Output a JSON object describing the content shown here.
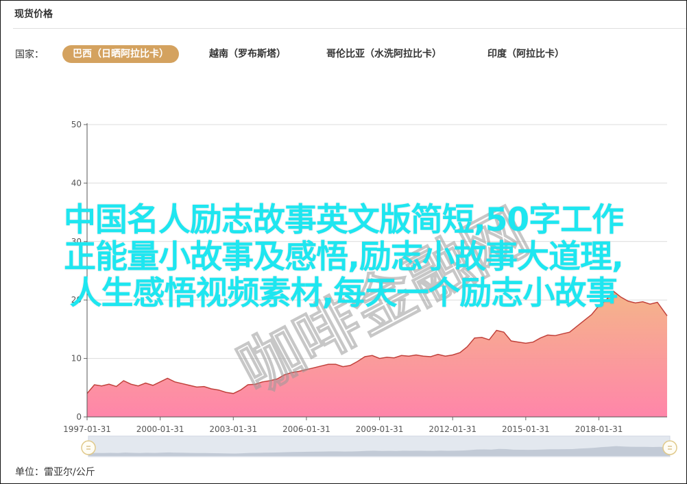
{
  "panel": {
    "title": "现货价格",
    "country_label": "国家：",
    "tabs": [
      {
        "label": "巴西（日晒阿拉比卡）",
        "active": true
      },
      {
        "label": "越南（罗布斯塔）",
        "active": false
      },
      {
        "label": "哥伦比亚（水洗阿拉比卡）",
        "active": false
      },
      {
        "label": "印度（阿拉比卡）",
        "active": false
      }
    ],
    "unit": "单位：雷亚尔/公斤",
    "accent": "#d4a25f"
  },
  "overlay": {
    "line1": "中国名人励志故事英文版简短,50字工作",
    "line2": "正能量小故事及感悟,励志小故事大道理,",
    "line3": "人生感悟视频素材,每天一个励志小故事",
    "color": "#1ee6f0"
  },
  "watermark": {
    "text": "咖啡金融网"
  },
  "chart_data": {
    "type": "area",
    "x_tick_labels": [
      "1997-01-31",
      "2000-01-31",
      "2003-01-31",
      "2006-01-31",
      "2009-01-31",
      "2012-01-31",
      "2015-01-31",
      "2018-01-31"
    ],
    "y_ticks": [
      0,
      10,
      20,
      30,
      40,
      50
    ],
    "ylim": [
      0,
      50
    ],
    "xlim": [
      1997.0,
      2020.8
    ],
    "grid": true,
    "colors": {
      "top": "#f4b183",
      "bottom": "#ff7fa5",
      "line": "#c0403a"
    },
    "data_zoom": {
      "start": 0,
      "end": 100
    },
    "x": [
      1997.0,
      1997.3,
      1997.6,
      1997.9,
      1998.2,
      1998.5,
      1998.8,
      1999.1,
      1999.4,
      1999.7,
      2000.0,
      2000.3,
      2000.6,
      2000.9,
      2001.2,
      2001.5,
      2001.8,
      2002.1,
      2002.4,
      2002.7,
      2003.0,
      2003.3,
      2003.6,
      2003.9,
      2004.2,
      2004.5,
      2004.8,
      2005.1,
      2005.4,
      2005.7,
      2006.0,
      2006.3,
      2006.6,
      2006.9,
      2007.2,
      2007.5,
      2007.8,
      2008.1,
      2008.4,
      2008.7,
      2009.0,
      2009.3,
      2009.6,
      2009.9,
      2010.2,
      2010.5,
      2010.8,
      2011.1,
      2011.4,
      2011.7,
      2012.0,
      2012.3,
      2012.6,
      2012.9,
      2013.2,
      2013.5,
      2013.8,
      2014.1,
      2014.4,
      2014.7,
      2015.0,
      2015.3,
      2015.6,
      2015.9,
      2016.2,
      2016.5,
      2016.8,
      2017.1,
      2017.4,
      2017.7,
      2018.0,
      2018.3,
      2018.6,
      2018.9,
      2019.2,
      2019.5,
      2019.8,
      2020.1,
      2020.4,
      2020.8
    ],
    "values": [
      4.0,
      5.5,
      5.3,
      5.6,
      5.2,
      6.2,
      5.6,
      5.3,
      5.8,
      5.4,
      6.0,
      6.6,
      6.0,
      5.7,
      5.4,
      5.1,
      5.2,
      4.8,
      4.6,
      4.2,
      4.0,
      4.6,
      5.5,
      5.6,
      6.0,
      6.2,
      6.5,
      7.2,
      7.6,
      7.8,
      8.1,
      8.4,
      8.7,
      9.0,
      9.0,
      8.6,
      8.8,
      9.5,
      10.3,
      10.5,
      10.0,
      10.2,
      10.1,
      10.5,
      10.4,
      10.6,
      10.4,
      10.3,
      10.7,
      10.4,
      10.6,
      11.0,
      12.0,
      13.5,
      13.6,
      13.2,
      14.8,
      14.5,
      13.0,
      12.8,
      12.6,
      12.8,
      13.5,
      14.0,
      13.9,
      14.2,
      14.5,
      15.5,
      16.5,
      17.5,
      19.0,
      20.0,
      21.5,
      20.5,
      19.8,
      19.5,
      19.7,
      19.3,
      19.6,
      17.3
    ]
  }
}
